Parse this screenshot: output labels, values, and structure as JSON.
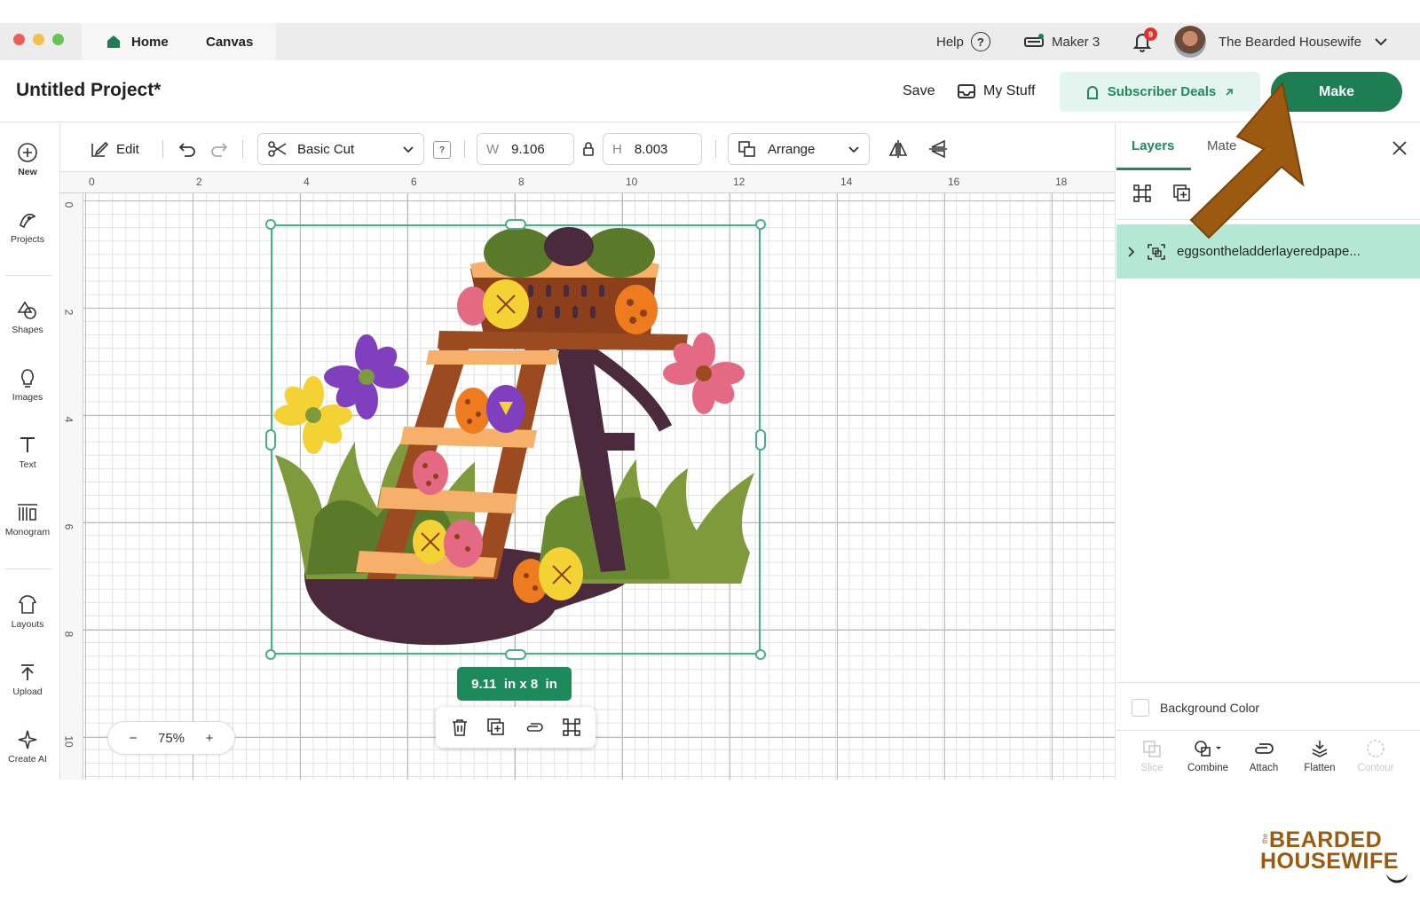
{
  "titlebar": {
    "tabs": [
      {
        "label": "Home"
      },
      {
        "label": "Canvas"
      }
    ],
    "help_label": "Help",
    "machine_label": "Maker 3",
    "notification_count": "9",
    "user_name": "The Bearded Housewife"
  },
  "header": {
    "project_title": "Untitled Project*",
    "save_label": "Save",
    "mystuff_label": "My Stuff",
    "subscriber_label": "Subscriber Deals",
    "make_label": "Make"
  },
  "sidebar": {
    "items": [
      {
        "label": "New",
        "icon": "plus-circle-icon"
      },
      {
        "label": "Projects",
        "icon": "projects-icon"
      },
      {
        "label": "Shapes",
        "icon": "shapes-icon"
      },
      {
        "label": "Images",
        "icon": "lightbulb-icon"
      },
      {
        "label": "Text",
        "icon": "text-icon"
      },
      {
        "label": "Monogram",
        "icon": "monogram-icon"
      },
      {
        "label": "Layouts",
        "icon": "layouts-icon"
      },
      {
        "label": "Upload",
        "icon": "upload-icon"
      },
      {
        "label": "Create AI",
        "icon": "sparkle-icon"
      }
    ]
  },
  "toolbar": {
    "edit_label": "Edit",
    "operation_value": "Basic Cut",
    "help_glyph": "?",
    "width_label": "W",
    "width_value": "9.106",
    "height_label": "H",
    "height_value": "8.003",
    "arrange_label": "Arrange"
  },
  "rulers": {
    "top": [
      "0",
      "2",
      "4",
      "6",
      "8",
      "10",
      "12",
      "14",
      "16",
      "18"
    ],
    "left": [
      "0",
      "2",
      "4",
      "6",
      "8",
      "10"
    ]
  },
  "canvas": {
    "size_label": "9.11  in x 8  in",
    "zoom_minus": "−",
    "zoom_value": "75%",
    "zoom_plus": "+"
  },
  "panel": {
    "tabs": [
      {
        "label": "Layers"
      },
      {
        "label": "Mate"
      }
    ],
    "layer_name": "eggsontheladderlayeredpape...",
    "background_label": "Background Color",
    "bottom_tools": [
      {
        "label": "Slice",
        "enabled": false
      },
      {
        "label": "Combine",
        "enabled": true
      },
      {
        "label": "Attach",
        "enabled": true
      },
      {
        "label": "Flatten",
        "enabled": true
      },
      {
        "label": "Contour",
        "enabled": false
      }
    ]
  },
  "watermark": {
    "small": "the",
    "line1": "BEARDED",
    "line2": "HOUSEWIFE"
  },
  "colors": {
    "accent_green": "#1d7d53",
    "selection_green": "#45b08c",
    "layer_highlight": "#b4e8d4",
    "arrow_brown": "#9b5a10",
    "egg_brown": "#8b3f1a",
    "ladder_brown": "#9c4a1f",
    "dark_plum": "#4a2a3c",
    "grass_green": "#7e9a3a",
    "peach": "#f7b06a",
    "yellow": "#f5d233",
    "purple": "#7f3fbf",
    "pink": "#e46a83",
    "orange": "#ee7b1e"
  }
}
